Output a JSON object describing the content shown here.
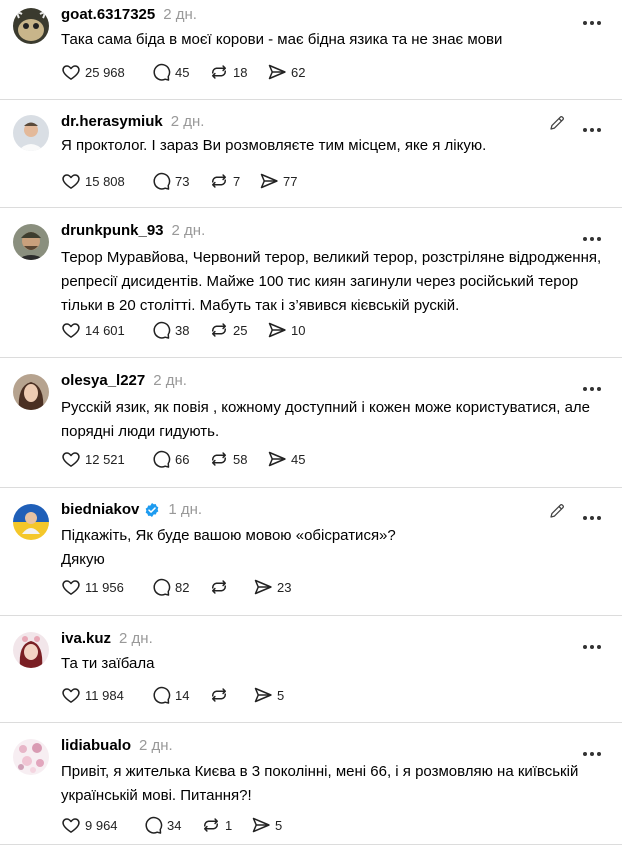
{
  "posts": [
    {
      "username": "goat.6317325",
      "time": "2 дн.",
      "text": "Така сама біда в моєї корови - має бідна язика та не знає мови",
      "likes": "25 968",
      "replies": "45",
      "reposts": "18",
      "shares": "62",
      "edit": false,
      "verified": false
    },
    {
      "username": "dr.herasymiuk",
      "time": "2 дн.",
      "text": "Я проктолог. І зараз Ви розмовляєте тим місцем, яке я лікую.",
      "likes": "15 808",
      "replies": "73",
      "reposts": "7",
      "shares": "77",
      "edit": true,
      "verified": false
    },
    {
      "username": "drunkpunk_93",
      "time": "2 дн.",
      "text": "Терор Муравйова, Червоний терор, великий терор, розстріляне відродження,\nрепресії дисидентів. Майже 100 тис киян загинули через російський терор\nтільки в 20 столітті. Мабуть так і з’явився кієвській рускій.",
      "likes": "14 601",
      "replies": "38",
      "reposts": "25",
      "shares": "10",
      "edit": false,
      "verified": false
    },
    {
      "username": "olesya_l227",
      "time": "2 дн.",
      "text": "Русскій язик, як повія , кожному доступний і кожен може користуватися, але\nпорядні люди гидують.",
      "likes": "12 521",
      "replies": "66",
      "reposts": "58",
      "shares": "45",
      "edit": false,
      "verified": false
    },
    {
      "username": "biedniakov",
      "time": "1 дн.",
      "text": "Підкажіть, Як буде вашою мовою «обісратися»?\nДякую",
      "likes": "11 956",
      "replies": "82",
      "reposts": "",
      "shares": "23",
      "edit": true,
      "verified": true
    },
    {
      "username": "iva.kuz",
      "time": "2 дн.",
      "text": "Та ти заїбала",
      "likes": "11 984",
      "replies": "14",
      "reposts": "",
      "shares": "5",
      "edit": false,
      "verified": false
    },
    {
      "username": "lidiabualo",
      "time": "2 дн.",
      "text": "Привіт, я жителька Києва в 3 поколінні, мені 66, і я розмовляю на київській\nукраїнській мові. Питання?!",
      "likes": "9 964",
      "replies": "34",
      "reposts": "1",
      "shares": "5",
      "edit": false,
      "verified": false
    }
  ],
  "icons": {
    "like": "heart-icon",
    "reply": "comment-icon",
    "repost": "repost-icon",
    "share": "send-icon",
    "more": "more-options-icon",
    "edit": "edit-pencil-icon",
    "verified": "verified-badge-icon"
  },
  "colors": {
    "verified": "#1d9bf0",
    "muted": "#999999",
    "divider": "#dcdcdc"
  }
}
